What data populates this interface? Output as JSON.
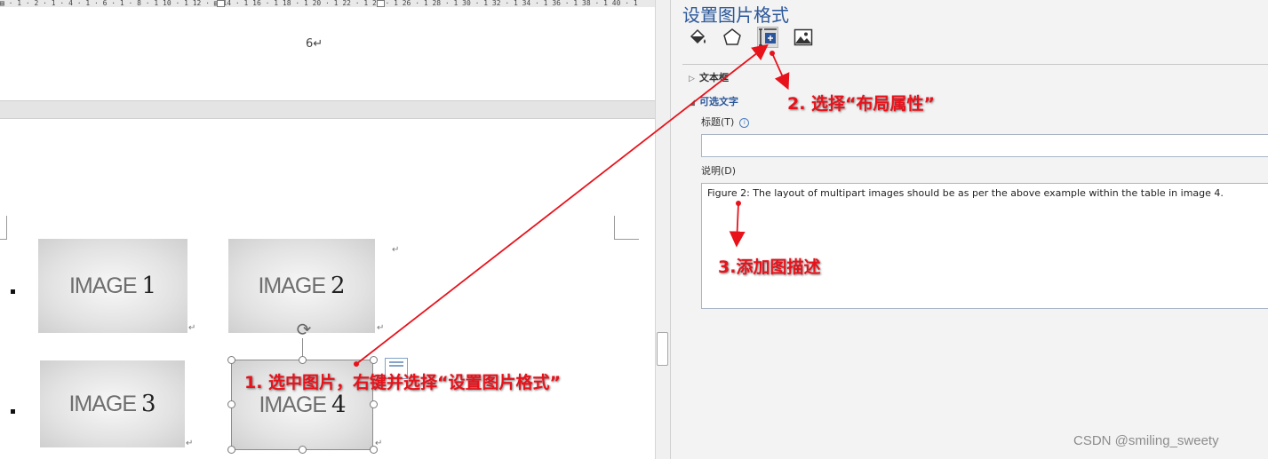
{
  "ruler": {
    "text": "▤ · 1 · 2 · 1 · 4 · 1 · 6 · 1 · 8 · 1 10 · 1 12 · ▤ 14 · 1 16 · 1 18 · 1 20 · 1 22 · 1 24 · 1 26 · 1 28 · 1 30 · 1 32 · 1 34 · 1 36 · 1 38 · 1 40 · 1"
  },
  "document": {
    "page_number": "6↵",
    "return_mark": "↵",
    "images": [
      {
        "label": "IMAGE",
        "number": "1"
      },
      {
        "label": "IMAGE",
        "number": "2"
      },
      {
        "label": "IMAGE",
        "number": "3"
      },
      {
        "label": "IMAGE",
        "number": "4"
      }
    ]
  },
  "pane": {
    "title": "设置图片格式",
    "tabs": [
      {
        "name": "fill-line-icon"
      },
      {
        "name": "effects-icon"
      },
      {
        "name": "layout-properties-icon",
        "active": true
      },
      {
        "name": "picture-icon"
      }
    ],
    "section_textbox": "文本框",
    "section_alt_text": "可选文字",
    "title_label": "标题(T)",
    "info_glyph": "i",
    "title_value": "",
    "desc_label": "说明(D)",
    "desc_value": "Figure 2: The layout of multipart images should be as per the above example within the table in image 4."
  },
  "annotations": {
    "step1": "1. 选中图片，右键并选择“设置图片格式”",
    "step2": "2. 选择“布局属性”",
    "step3": "3.添加图描述"
  },
  "colors": {
    "accent": "#2b579a",
    "annotation": "#e8121b"
  },
  "watermark": "CSDN @smiling_sweety"
}
